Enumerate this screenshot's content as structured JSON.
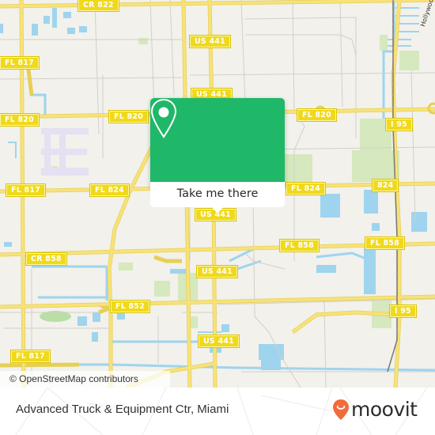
{
  "map": {
    "type": "street map",
    "colors": {
      "land": "#f2f1ec",
      "road_major": "#f7e27a",
      "road_major_casing": "#e7cf55",
      "road_minor": "#cfcbc4",
      "water": "#9fd4ee",
      "park": "#d6e8bd",
      "shield_fill": "#f0d91a",
      "rail": "#777777"
    },
    "shields": [
      {
        "label": "CR 822"
      },
      {
        "label": "US 441"
      },
      {
        "label": "FL 817"
      },
      {
        "label": "US 441"
      },
      {
        "label": "FL 820"
      },
      {
        "label": "FL 820"
      },
      {
        "label": "FL 820"
      },
      {
        "label": "I 95"
      },
      {
        "label": "FL 817"
      },
      {
        "label": "FL 824"
      },
      {
        "label": "FL 824"
      },
      {
        "label": "824"
      },
      {
        "label": "US 441"
      },
      {
        "label": "CR 858"
      },
      {
        "label": "FL 858"
      },
      {
        "label": "FL 858"
      },
      {
        "label": "US 441"
      },
      {
        "label": "FL 852"
      },
      {
        "label": "I 95"
      },
      {
        "label": "US 441"
      },
      {
        "label": "FL 817"
      }
    ],
    "place_labels": [
      "Hollywood"
    ],
    "attribution": "© OpenStreetMap contributors"
  },
  "popup": {
    "icon": "map-pin-icon",
    "action_label": "Take me there",
    "accent_color": "#1fb868"
  },
  "footer": {
    "place_name": "Advanced Truck & Equipment Ctr, Miami",
    "brand": "moovit",
    "brand_icon": "moovit-smiley-pin-icon",
    "brand_color": "#f26b3a"
  }
}
